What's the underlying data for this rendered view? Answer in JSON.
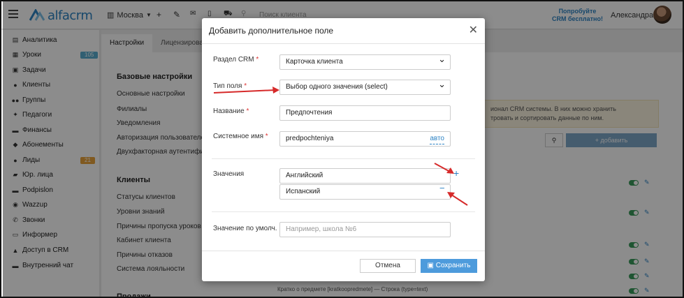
{
  "topbar": {
    "logo": "alfacrm",
    "branch": "Москва",
    "search_placeholder": "Поиск клиента",
    "promo_line1": "Попробуйте",
    "promo_line2": "CRM бесплатно!",
    "user_name": "Александра"
  },
  "sidebar": {
    "items": [
      {
        "label": "Аналитика",
        "icon": "chart-icon"
      },
      {
        "label": "Уроки",
        "icon": "calendar-icon",
        "badge": "105"
      },
      {
        "label": "Задачи",
        "icon": "tasks-icon"
      },
      {
        "label": "Клиенты",
        "icon": "user-icon"
      },
      {
        "label": "Группы",
        "icon": "users-icon"
      },
      {
        "label": "Педагоги",
        "icon": "teacher-icon"
      },
      {
        "label": "Финансы",
        "icon": "money-icon"
      },
      {
        "label": "Абонементы",
        "icon": "tag-icon"
      },
      {
        "label": "Лиды",
        "icon": "leads-icon",
        "badge": "21"
      },
      {
        "label": "Юр. лица",
        "icon": "briefcase-icon"
      },
      {
        "label": "Podpislon",
        "icon": "folder-icon"
      },
      {
        "label": "Wazzup",
        "icon": "whatsapp-icon"
      },
      {
        "label": "Звонки",
        "icon": "phone-icon"
      },
      {
        "label": "Информер",
        "icon": "inbox-icon"
      },
      {
        "label": "Доступ в CRM",
        "icon": "lock-icon"
      },
      {
        "label": "Внутренний чат",
        "icon": "chat-icon"
      }
    ],
    "badge_colors": {
      "blue": "#5aaed0",
      "orange": "#e9a23b"
    }
  },
  "content": {
    "tabs": [
      "Настройки",
      "Лицензирован"
    ],
    "basic_heading": "Базовые настройки",
    "basic_links": [
      "Основные настройки",
      "Филиалы",
      "Уведомления",
      "Авторизация пользователей",
      "Двухфакторная аутентифика"
    ],
    "clients_heading": "Клиенты",
    "clients_links": [
      "Статусы клиентов",
      "Уровни знаний",
      "Причины пропуска уроков",
      "Кабинет клиента",
      "Причины отказов",
      "Система лояльности"
    ],
    "bottom_heading": "Продажи",
    "info_text_1": "ионал CRM системы. В них можно хранить",
    "info_text_2": "тровать и сортировать данные по ним.",
    "add_button": "+ добавить",
    "row_text": "Кратко о предмете [kratkoopredmete] — Строка (type=text)"
  },
  "modal": {
    "title": "Добавить дополнительное поле",
    "section_label": "Раздел CRM",
    "section_value": "Карточка клиента",
    "type_label": "Тип поля",
    "type_value": "Выбор одного значения (select)",
    "name_label": "Название",
    "name_value": "Предпочтения",
    "sysname_label": "Системное имя",
    "sysname_value": "predpochteniya",
    "auto_link": "авто",
    "values_label": "Значения",
    "values": [
      "Английский",
      "Испанский"
    ],
    "default_label": "Значение по умолч.",
    "default_placeholder": "Например, школа №6",
    "required_mark": "*",
    "cancel_label": "Отмена",
    "save_label": "Сохранить"
  },
  "colors": {
    "brand": "#2d83c4",
    "save": "#4d9bdc",
    "annotation": "#d62a2a"
  }
}
